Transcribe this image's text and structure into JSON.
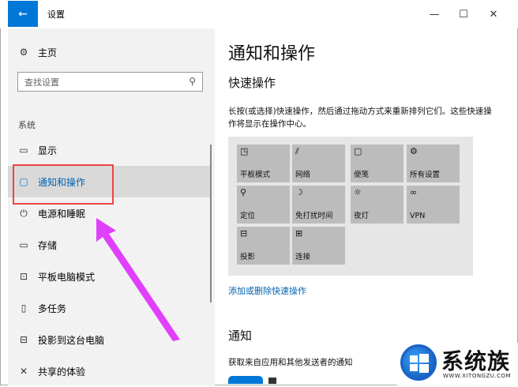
{
  "window": {
    "title": "设置",
    "back_icon": "back-arrow-icon"
  },
  "sidebar": {
    "home_label": "主页",
    "search_placeholder": "查找设置",
    "section_label": "系统",
    "items": [
      {
        "label": "显示",
        "icon": "display-icon"
      },
      {
        "label": "通知和操作",
        "icon": "notification-icon",
        "active": true
      },
      {
        "label": "电源和睡眠",
        "icon": "power-icon"
      },
      {
        "label": "存储",
        "icon": "storage-icon"
      },
      {
        "label": "平板电脑模式",
        "icon": "tablet-icon"
      },
      {
        "label": "多任务",
        "icon": "multitask-icon"
      },
      {
        "label": "投影到这台电脑",
        "icon": "project-icon"
      },
      {
        "label": "共享的体验",
        "icon": "shared-icon"
      }
    ]
  },
  "main": {
    "title": "通知和操作",
    "quick_actions_heading": "快速操作",
    "quick_actions_desc": "长按(或选择)快速操作，然后通过拖动方式来重新排列它们。这些快速操作将显示在操作中心。",
    "tiles": [
      {
        "label": "平板模式",
        "icon": "tablet-mode-icon"
      },
      {
        "label": "网络",
        "icon": "network-icon"
      },
      {
        "label": "便笺",
        "icon": "note-icon"
      },
      {
        "label": "所有设置",
        "icon": "settings-icon"
      },
      {
        "label": "定位",
        "icon": "location-icon"
      },
      {
        "label": "免打扰时间",
        "icon": "moon-icon"
      },
      {
        "label": "夜灯",
        "icon": "sun-icon"
      },
      {
        "label": "VPN",
        "icon": "vpn-icon"
      },
      {
        "label": "投影",
        "icon": "project-icon"
      },
      {
        "label": "连接",
        "icon": "connect-icon"
      }
    ],
    "add_remove_link": "添加或删除快速操作",
    "notifications_heading": "通知",
    "notifications_desc": "获取来自应用和其他发送者的通知"
  },
  "watermark": {
    "brand": "系统族",
    "url": "WWW.XITONGZU.COM"
  },
  "colors": {
    "accent": "#0078d7",
    "highlight_box": "#ef4444",
    "arrow": "#e040fb"
  }
}
